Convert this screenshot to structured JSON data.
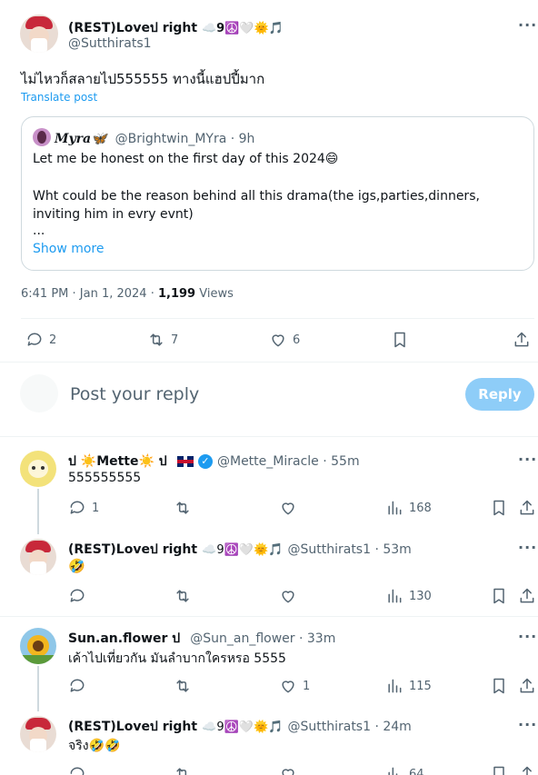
{
  "main_post": {
    "author_name": "(REST)Loveป right",
    "author_emojis": "☁️9☮️🤍🌞🎵",
    "handle": "@Sutthirats1",
    "text": "ไม่ไหวก็สลายไป555555 ทางนี้แฮปปี้มาก",
    "translate": "Translate post",
    "timestamp": "6:41 PM · Jan 1, 2024 ·",
    "views_count": "1,199",
    "views_label": "Views",
    "replies": "2",
    "reposts": "7",
    "likes": "6"
  },
  "quote": {
    "author_name": "𝑴𝒚𝒓𝒂🦋",
    "handle_time": "@Brightwin_MYra · 9h",
    "line1": "Let me be honest on the first day of this 2024😄",
    "line2": "Wht could be the reason behind all this drama(the igs,parties,dinners, inviting him in evry evnt)",
    "ellipsis": "...",
    "show_more": "Show more"
  },
  "reply_box": {
    "placeholder": "Post your reply",
    "button": "Reply"
  },
  "replies": [
    {
      "name": "ป  ☀️Mette☀️ ป",
      "handle_time": "@Mette_Miracle · 55m",
      "text": "555555555",
      "reply_count": "1",
      "repost_count": "",
      "like_count": "",
      "views": "168"
    },
    {
      "name": "(REST)Loveป right",
      "emojis": "☁️9☮️🤍🌞🎵",
      "handle_time": "@Sutthirats1 · 53m",
      "text": "🤣",
      "reply_count": "",
      "repost_count": "",
      "like_count": "",
      "views": "130"
    },
    {
      "name": "Sun.an.flower ป",
      "handle_time": "@Sun_an_flower · 33m",
      "text": "เค้าไปเที่ยวกัน มันลำบากใครหรอ 5555",
      "reply_count": "",
      "repost_count": "",
      "like_count": "1",
      "views": "115"
    },
    {
      "name": "(REST)Loveป right",
      "emojis": "☁️9☮️🤍🌞🎵",
      "handle_time": "@Sutthirats1 · 24m",
      "text": "จริง🤣🤣",
      "reply_count": "",
      "repost_count": "",
      "like_count": "",
      "views": "64"
    }
  ],
  "colors": {
    "accent": "#1d9bf0",
    "reply_button_disabled": "#8ecdf8",
    "secondary_text": "#536471"
  }
}
